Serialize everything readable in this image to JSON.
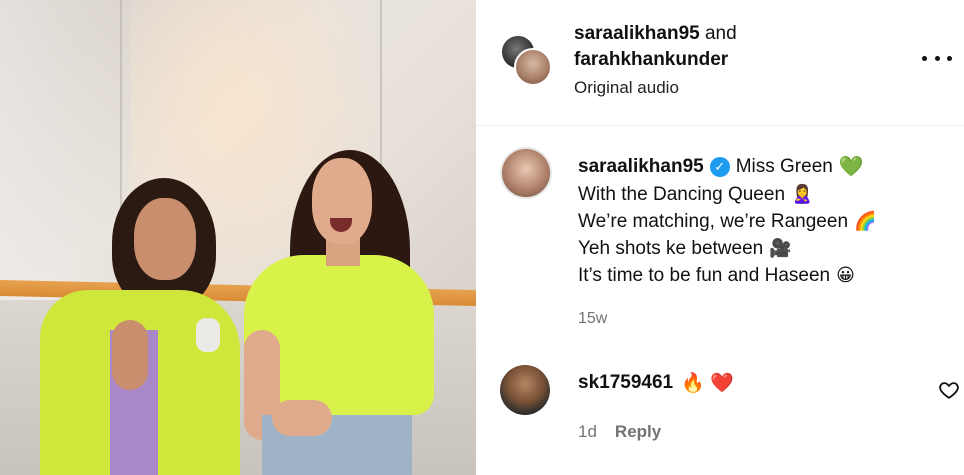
{
  "post": {
    "authors": {
      "primary": "saraalikhan95",
      "joiner": "and",
      "secondary": "farahkhankunder"
    },
    "audio": "Original audio",
    "more_icon": "more-horizontal-icon"
  },
  "caption": {
    "username": "saraalikhan95",
    "verified_icon": "verified-badge-icon",
    "first_line": "Miss Green",
    "first_line_emoji": "💚",
    "lines": [
      {
        "text": "With the Dancing Queen",
        "emoji": "🙎‍♀️"
      },
      {
        "text": "We’re matching, we’re Rangeen",
        "emoji": "🌈"
      },
      {
        "text": "Yeh shots ke between",
        "emoji": "🎥"
      },
      {
        "text": "It’s time to be fun and Haseen",
        "emoji": "😀"
      }
    ],
    "time": "15w"
  },
  "comment": {
    "username": "sk1759461",
    "text": "🔥 ❤️",
    "time": "1d",
    "reply_label": "Reply",
    "like_icon": "heart-outline-icon"
  },
  "colors": {
    "verified": "#1d9bf0",
    "meta_text": "#737373",
    "divider": "#efefef"
  }
}
